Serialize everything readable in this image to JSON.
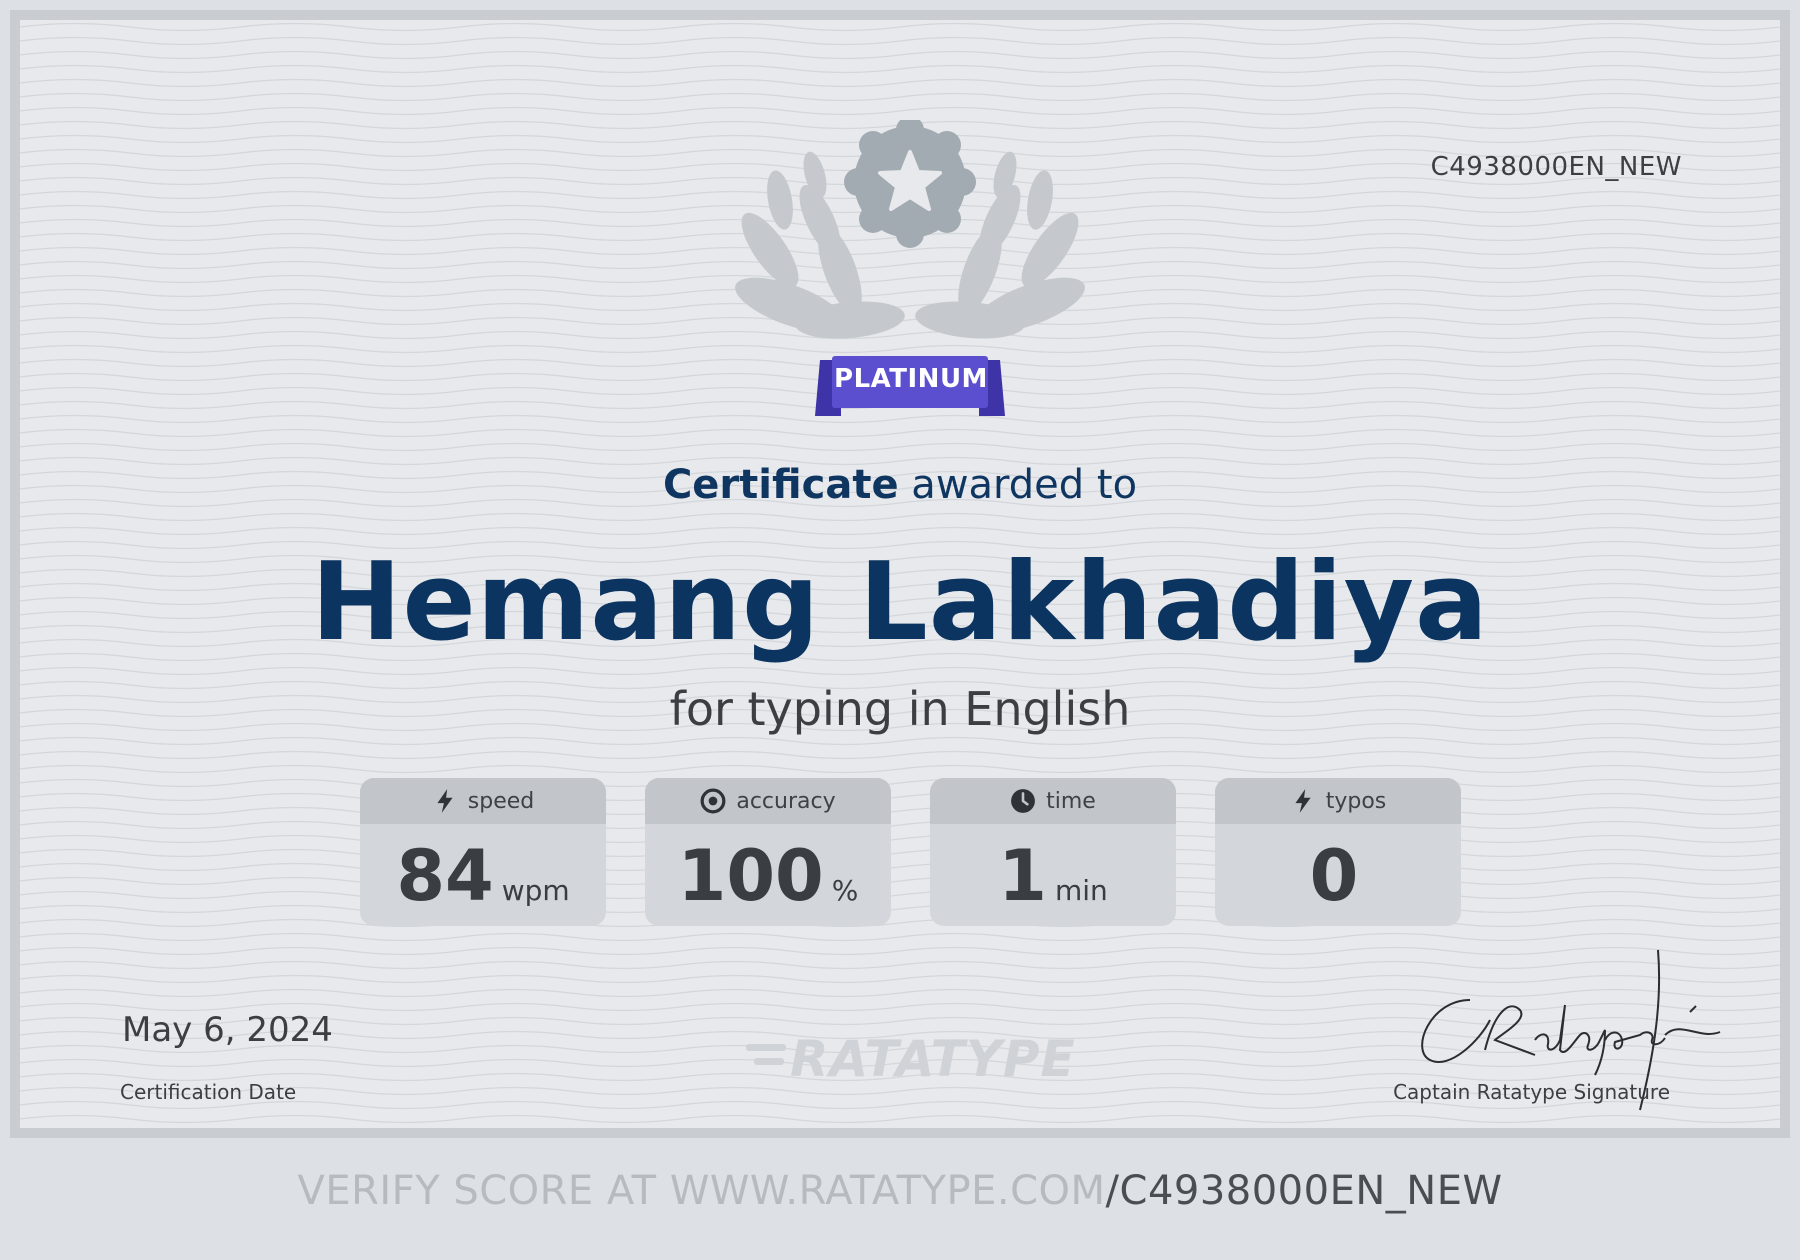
{
  "certificate": {
    "code": "C4938000EN_NEW",
    "badge": "PLATINUM",
    "awarded_strong": "Certificate",
    "awarded_rest": " awarded to",
    "name": "Hemang Lakhadiya",
    "subtitle": "for typing in English",
    "stats": [
      {
        "icon": "lightning-icon",
        "label": "speed",
        "value": "84",
        "unit": "wpm"
      },
      {
        "icon": "target-icon",
        "label": "accuracy",
        "value": "100",
        "unit": "%"
      },
      {
        "icon": "clock-icon",
        "label": "time",
        "value": "1",
        "unit": "min"
      },
      {
        "icon": "lightning-icon",
        "label": "typos",
        "value": "0",
        "unit": ""
      }
    ],
    "date": "May 6, 2024",
    "date_label": "Certification Date",
    "logo": "RATATYPE",
    "signature_label": "Captain Ratatype Signature",
    "signature_text": "CRatatype"
  },
  "footer": {
    "verify_prefix": "VERIFY SCORE AT WWW.RATATYPE.COM",
    "verify_suffix": "/C4938000EN_NEW"
  },
  "colors": {
    "badge": "#5b4fd0",
    "name": "#0b3460",
    "emblem": "#a3abb2"
  }
}
